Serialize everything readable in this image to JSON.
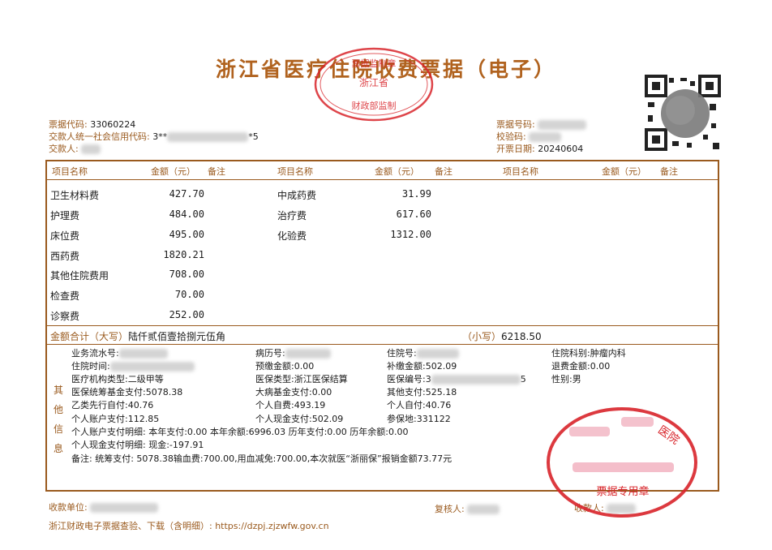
{
  "title": "浙江省医疗住院收费票据（电子）",
  "seal_top": {
    "text_top": "票据监制章",
    "text_mid": "浙江省",
    "text_bottom": "财政部监制"
  },
  "header_left": {
    "code_label": "票据代码:",
    "code_value": "33060224",
    "payer_id_label": "交款人统一社会信用代码:",
    "payer_id_prefix": "3**",
    "payer_id_suffix": "*5",
    "payer_label": "交款人:"
  },
  "header_right": {
    "number_label": "票据号码:",
    "check_label": "校验码:",
    "date_label": "开票日期:",
    "date_value": "20240604"
  },
  "columns": {
    "name": "项目名称",
    "amount": "金额（元）",
    "note": "备注"
  },
  "items_col1": [
    {
      "name": "卫生材料费",
      "amount": "427.70"
    },
    {
      "name": "护理费",
      "amount": "484.00"
    },
    {
      "name": "床位费",
      "amount": "495.00"
    },
    {
      "name": "西药费",
      "amount": "1820.21"
    },
    {
      "name": "其他住院费用",
      "amount": "708.00"
    },
    {
      "name": "检查费",
      "amount": "70.00"
    },
    {
      "name": "诊察费",
      "amount": "252.00"
    }
  ],
  "items_col2": [
    {
      "name": "中成药费",
      "amount": "31.99"
    },
    {
      "name": "治疗费",
      "amount": "617.60"
    },
    {
      "name": "化验费",
      "amount": "1312.00"
    }
  ],
  "total": {
    "upper_label": "金额合计（大写）",
    "upper_value": "陆仟贰佰壹拾捌元伍角",
    "lower_label": "（小写）",
    "lower_value": "6218.50"
  },
  "other_info_label": [
    "其",
    "他",
    "信",
    "息"
  ],
  "other_info": {
    "r1": {
      "serial": "业务流水号:",
      "record": "病历号:",
      "inpatient": "住院号:",
      "dept": "住院科别:肿瘤内科"
    },
    "r2": {
      "time": "住院时间:",
      "prepaid": "预缴金额:0.00",
      "supplement": "补缴金额:502.09",
      "refund": "退费金额:0.00"
    },
    "r3": {
      "inst_type": "医疗机构类型:二级甲等",
      "ins_type": "医保类型:浙江医保结算",
      "ins_no_prefix": "医保编号:3",
      "ins_no_suffix": "5",
      "gender": "性别:男"
    },
    "r4": {
      "pool": "医保统筹基金支付:5078.38",
      "critical": "大病基金支付:0.00",
      "other_pay": "其他支付:525.18"
    },
    "r5": {
      "classb": "乙类先行自付:40.76",
      "self_fee": "个人自费:493.19",
      "self_pay": "个人自付:40.76"
    },
    "r6": {
      "account": "个人账户支付:112.85",
      "cash": "个人现金支付:502.09",
      "place": "参保地:331122"
    },
    "r7": "个人账户支付明细: 本年支付:0.00 本年余额:6996.03 历年支付:0.00 历年余额:0.00",
    "r8": "个人现金支付明细: 现金:-197.91",
    "r9": "备注: 统筹支付: 5078.38输血费:700.00,用血减免:700.00,本次就医“浙丽保”报销金额73.77元"
  },
  "footer": {
    "payee_unit": "收款单位:",
    "reviewer": "复核人:",
    "collector": "收款人:",
    "link": "浙江财政电子票据查验、下载（含明细）: https://dzpj.zjzwfw.gov.cn"
  },
  "seal_hospital": {
    "text_top": "医院",
    "text_bottom": "票据专用章"
  },
  "colors": {
    "brown": "#9a5a1e",
    "seal_red": "#d8242a",
    "title": "#b0621e"
  }
}
